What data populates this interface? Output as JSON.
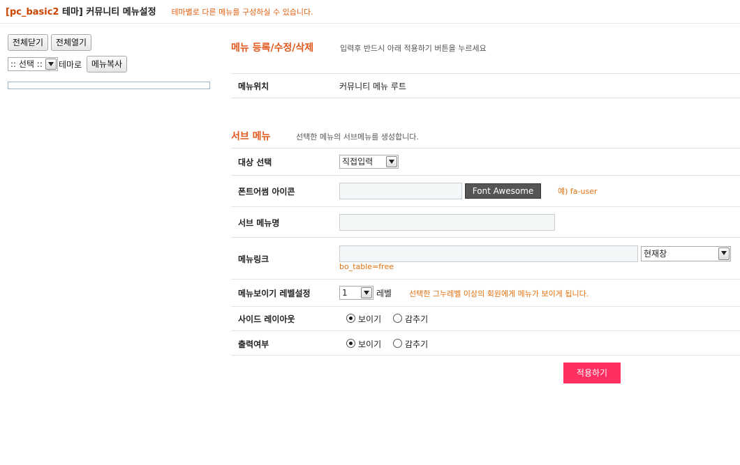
{
  "header": {
    "theme_name": "[pc_basic2",
    "title_rest": " 테마] 커뮤니티 메뉴설정",
    "description": "테마별로 다른 메뉴를 구성하실 수 있습니다."
  },
  "sidebar": {
    "collapse_all": "전체닫기",
    "expand_all": "전체열기",
    "theme_select_value": ":: 선택 ::",
    "theme_suffix": "테마로",
    "copy_menu": "메뉴복사"
  },
  "edit_section": {
    "title": "메뉴 등록/수정/삭제",
    "description": "입력후 반드시 아래 적용하기 버튼을 누르세요",
    "position_label": "메뉴위치",
    "position_value": "커뮤니티 메뉴 루트"
  },
  "sub_section": {
    "title": "서브 메뉴",
    "description": "선택한 메뉴의 서브메뉴를 생성합니다.",
    "target_label": "대상 선택",
    "target_value": "직접입력",
    "icon_label": "폰트어썸 아이콘",
    "icon_button": "Font Awesome",
    "icon_example": "예) fa-user",
    "name_label": "서브 메뉴명",
    "link_label": "메뉴링크",
    "link_target_value": "현재창",
    "link_hint": "bo_table=free",
    "level_label": "메뉴보이기 레벨설정",
    "level_value": "1",
    "level_suffix": "레벨",
    "level_note": "선택한 그누레벨 이상의 회원에게 메뉴가 보이게 됩니다.",
    "side_layout_label": "사이드 레이아웃",
    "output_label": "출력여부",
    "show_label": "보이기",
    "hide_label": "감추기",
    "side_layout_selected": "보이기",
    "output_selected": "보이기"
  },
  "apply_button": "적용하기"
}
